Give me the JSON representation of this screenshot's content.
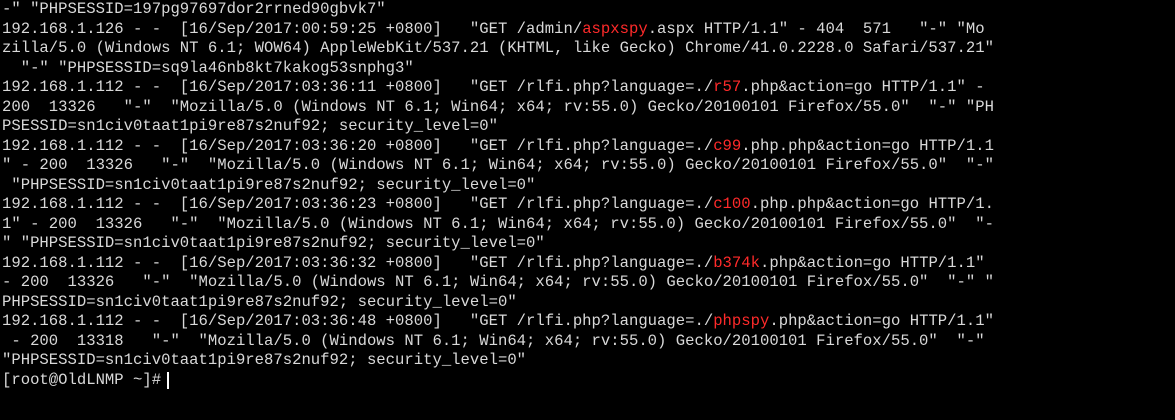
{
  "colors": {
    "background": "#000000",
    "text": "#d9d9d9",
    "highlight": "#ff2a2a"
  },
  "log": {
    "line_01": "-\" \"PHPSESSID=197pg97697dor2rrned90gbvk7\"",
    "e1_line1_a": "192.168.1.126 - -  [16/Sep/2017:00:59:25 +0800]   \"GET /admin/",
    "e1_line1_hl": "aspxspy",
    "e1_line1_b": ".aspx HTTP/1.1\" - 404  571   \"-\" \"Mo",
    "e1_line2": "zilla/5.0 (Windows NT 6.1; WOW64) AppleWebKit/537.21 (KHTML, like Gecko) Chrome/41.0.2228.0 Safari/537.21\"",
    "e1_line3": "  \"-\" \"PHPSESSID=sq9la46nb8kt7kakog53snphg3\"",
    "e2_line1_a": "192.168.1.112 - -  [16/Sep/2017:03:36:11 +0800]   \"GET /rlfi.php?language=./",
    "e2_line1_hl": "r57",
    "e2_line1_b": ".php&action=go HTTP/1.1\" -",
    "e2_line2": "200  13326   \"-\"  \"Mozilla/5.0 (Windows NT 6.1; Win64; x64; rv:55.0) Gecko/20100101 Firefox/55.0\"  \"-\" \"PH",
    "e2_line3": "PSESSID=sn1civ0taat1pi9re87s2nuf92; security_level=0\"",
    "e3_line1_a": "192.168.1.112 - -  [16/Sep/2017:03:36:20 +0800]   \"GET /rlfi.php?language=./",
    "e3_line1_hl": "c99",
    "e3_line1_b": ".php.php&action=go HTTP/1.1",
    "e3_line2": "\" - 200  13326   \"-\"  \"Mozilla/5.0 (Windows NT 6.1; Win64; x64; rv:55.0) Gecko/20100101 Firefox/55.0\"  \"-\"",
    "e3_line3": " \"PHPSESSID=sn1civ0taat1pi9re87s2nuf92; security_level=0\"",
    "e4_line1_a": "192.168.1.112 - -  [16/Sep/2017:03:36:23 +0800]   \"GET /rlfi.php?language=./",
    "e4_line1_hl": "c100",
    "e4_line1_b": ".php.php&action=go HTTP/1.",
    "e4_line2": "1\" - 200  13326   \"-\"  \"Mozilla/5.0 (Windows NT 6.1; Win64; x64; rv:55.0) Gecko/20100101 Firefox/55.0\"  \"-",
    "e4_line3": "\" \"PHPSESSID=sn1civ0taat1pi9re87s2nuf92; security_level=0\"",
    "e5_line1_a": "192.168.1.112 - -  [16/Sep/2017:03:36:32 +0800]   \"GET /rlfi.php?language=./",
    "e5_line1_hl": "b374k",
    "e5_line1_b": ".php&action=go HTTP/1.1\"",
    "e5_line2": "- 200  13326   \"-\"  \"Mozilla/5.0 (Windows NT 6.1; Win64; x64; rv:55.0) Gecko/20100101 Firefox/55.0\"  \"-\" \"",
    "e5_line3": "PHPSESSID=sn1civ0taat1pi9re87s2nuf92; security_level=0\"",
    "e6_line1_a": "192.168.1.112 - -  [16/Sep/2017:03:36:48 +0800]   \"GET /rlfi.php?language=./",
    "e6_line1_hl": "phpspy",
    "e6_line1_b": ".php&action=go HTTP/1.1\"",
    "e6_line2": " - 200  13318   \"-\"  \"Mozilla/5.0 (Windows NT 6.1; Win64; x64; rv:55.0) Gecko/20100101 Firefox/55.0\"  \"-\"",
    "e6_line3": "\"PHPSESSID=sn1civ0taat1pi9re87s2nuf92; security_level=0\""
  },
  "prompt": {
    "text": "[root@OldLNMP ~]#"
  }
}
